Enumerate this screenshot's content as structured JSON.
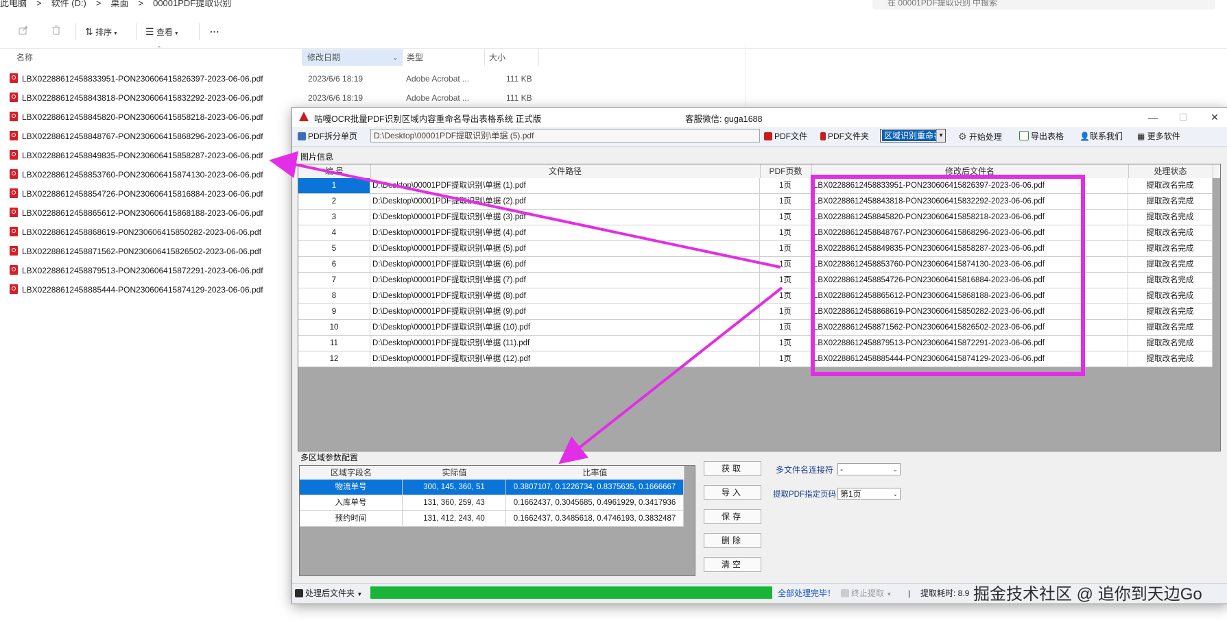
{
  "explorer": {
    "breadcrumb": [
      "此电脑",
      ">",
      "软件 (D:)",
      ">",
      "桌面",
      ">",
      "00001PDF提取识别"
    ],
    "search_placeholder": "在 00001PDF提取识别 中搜索",
    "toolbar": {
      "sort": "排序",
      "view": "查看",
      "more": "···"
    },
    "columns": {
      "name": "名称",
      "date": "修改日期",
      "type": "类型",
      "size": "大小"
    },
    "files": [
      {
        "name": "LBX02288612458833951-PON230606415826397-2023-06-06.pdf",
        "date": "2023/6/6 18:19",
        "type": "Adobe Acrobat ...",
        "size": "111 KB"
      },
      {
        "name": "LBX02288612458843818-PON230606415832292-2023-06-06.pdf",
        "date": "2023/6/6 18:19",
        "type": "Adobe Acrobat ...",
        "size": "111 KB"
      },
      {
        "name": "LBX02288612458845820-PON230606415858218-2023-06-06.pdf",
        "date": "",
        "type": "",
        "size": ""
      },
      {
        "name": "LBX02288612458848767-PON230606415868296-2023-06-06.pdf",
        "date": "",
        "type": "",
        "size": ""
      },
      {
        "name": "LBX02288612458849835-PON230606415858287-2023-06-06.pdf",
        "date": "",
        "type": "",
        "size": ""
      },
      {
        "name": "LBX02288612458853760-PON230606415874130-2023-06-06.pdf",
        "date": "",
        "type": "",
        "size": ""
      },
      {
        "name": "LBX02288612458854726-PON230606415816884-2023-06-06.pdf",
        "date": "",
        "type": "",
        "size": ""
      },
      {
        "name": "LBX02288612458865612-PON230606415868188-2023-06-06.pdf",
        "date": "",
        "type": "",
        "size": ""
      },
      {
        "name": "LBX02288612458868619-P0N230606415850282-2023-06-06.pdf",
        "date": "",
        "type": "",
        "size": ""
      },
      {
        "name": "LBX02288612458871562-P0N230606415826502-2023-06-06.pdf",
        "date": "",
        "type": "",
        "size": ""
      },
      {
        "name": "LBX02288612458879513-PON230606415872291-2023-06-06.pdf",
        "date": "",
        "type": "",
        "size": ""
      },
      {
        "name": "LBX02288612458885444-PON230606415874129-2023-06-06.pdf",
        "date": "",
        "type": "",
        "size": ""
      }
    ]
  },
  "app": {
    "title": "咕嘎OCR批量PDF识别区域内容重命名导出表格系统   正式版",
    "wechat": "客服微信: guga1688",
    "toolbar": {
      "split": "PDF拆分单页",
      "path": "D:\\Desktop\\00001PDF提取识别\\单据 (5).pdf",
      "pdf_file": "PDF文件",
      "pdf_folder": "PDF文件夹",
      "mode": "区域识别重命名",
      "start": "开始处理",
      "export": "导出表格",
      "contact": "联系我们",
      "more": "更多软件"
    },
    "image_info_label": "图片信息",
    "grid": {
      "headers": [
        "编 号",
        "文件路径",
        "PDF页数",
        "修改后文件名",
        "处理状态"
      ],
      "rows": [
        {
          "no": "1",
          "path": "D:\\Desktop\\00001PDF提取识别\\单据 (1).pdf",
          "pages": "1页",
          "newname": "LBX02288612458833951-PON230606415826397-2023-06-06.pdf",
          "status": "提取改名完成"
        },
        {
          "no": "2",
          "path": "D:\\Desktop\\00001PDF提取识别\\单据 (2).pdf",
          "pages": "1页",
          "newname": "LBX02288612458843818-PON230606415832292-2023-06-06.pdf",
          "status": "提取改名完成"
        },
        {
          "no": "3",
          "path": "D:\\Desktop\\00001PDF提取识别\\单据 (3).pdf",
          "pages": "1页",
          "newname": "LBX02288612458845820-PON230606415858218-2023-06-06.pdf",
          "status": "提取改名完成"
        },
        {
          "no": "4",
          "path": "D:\\Desktop\\00001PDF提取识别\\单据 (4).pdf",
          "pages": "1页",
          "newname": "LBX02288612458848767-PON230606415868296-2023-06-06.pdf",
          "status": "提取改名完成"
        },
        {
          "no": "5",
          "path": "D:\\Desktop\\00001PDF提取识别\\单据 (5).pdf",
          "pages": "1页",
          "newname": "LBX02288612458849835-PON230606415858287-2023-06-06.pdf",
          "status": "提取改名完成"
        },
        {
          "no": "6",
          "path": "D:\\Desktop\\00001PDF提取识别\\单据 (6).pdf",
          "pages": "1页",
          "newname": "LBX02288612458853760-PON230606415874130-2023-06-06.pdf",
          "status": "提取改名完成"
        },
        {
          "no": "7",
          "path": "D:\\Desktop\\00001PDF提取识别\\单据 (7).pdf",
          "pages": "1页",
          "newname": "LBX02288612458854726-PON230606415816884-2023-06-06.pdf",
          "status": "提取改名完成"
        },
        {
          "no": "8",
          "path": "D:\\Desktop\\00001PDF提取识别\\单据 (8).pdf",
          "pages": "1页",
          "newname": "LBX02288612458865612-PON230606415868188-2023-06-06.pdf",
          "status": "提取改名完成"
        },
        {
          "no": "9",
          "path": "D:\\Desktop\\00001PDF提取识别\\单据 (9).pdf",
          "pages": "1页",
          "newname": "LBX02288612458868619-PON230606415850282-2023-06-06.pdf",
          "status": "提取改名完成"
        },
        {
          "no": "10",
          "path": "D:\\Desktop\\00001PDF提取识别\\单据 (10).pdf",
          "pages": "1页",
          "newname": "LBX02288612458871562-PON230606415826502-2023-06-06.pdf",
          "status": "提取改名完成"
        },
        {
          "no": "11",
          "path": "D:\\Desktop\\00001PDF提取识别\\单据 (11).pdf",
          "pages": "1页",
          "newname": "LBX02288612458879513-PON230606415872291-2023-06-06.pdf",
          "status": "提取改名完成"
        },
        {
          "no": "12",
          "path": "D:\\Desktop\\00001PDF提取识别\\单据 (12).pdf",
          "pages": "1页",
          "newname": "LBX02288612458885444-PON230606415874129-2023-06-06.pdf",
          "status": "提取改名完成"
        }
      ]
    },
    "params_label": "多区域参数配置",
    "params": {
      "headers": [
        "区域字段名",
        "实际值",
        "比率值"
      ],
      "rows": [
        {
          "field": "物流单号",
          "actual": "300, 145, 360, 51",
          "ratio": "0.3807107, 0.1226734, 0.8375635, 0.1666667"
        },
        {
          "field": "入库单号",
          "actual": "131, 360, 259, 43",
          "ratio": "0.1662437, 0.3045685, 0.4961929, 0.3417936"
        },
        {
          "field": "预约时间",
          "actual": "131, 412, 243, 40",
          "ratio": "0.1662437, 0.3485618, 0.4746193, 0.3832487"
        }
      ]
    },
    "buttons": {
      "get": "获取",
      "import": "导入",
      "save": "保存",
      "delete": "删除",
      "clear": "清空"
    },
    "options": {
      "joiner_label": "多文件名连接符",
      "joiner_value": "-",
      "page_label": "提取PDF指定页码",
      "page_value": "第1页"
    },
    "status": {
      "output_folder": "处理后文件夹",
      "progress": 1.0,
      "done": "全部处理完毕！",
      "stop": "终止提取",
      "sep": "|",
      "elapsed": "提取耗时: 8.9"
    }
  },
  "watermark": "掘金技术社区 @ 追你到天边Go",
  "accent_colors": {
    "annotation": "#e22ee6",
    "selection": "#0a74d9",
    "progress": "#19b439"
  }
}
